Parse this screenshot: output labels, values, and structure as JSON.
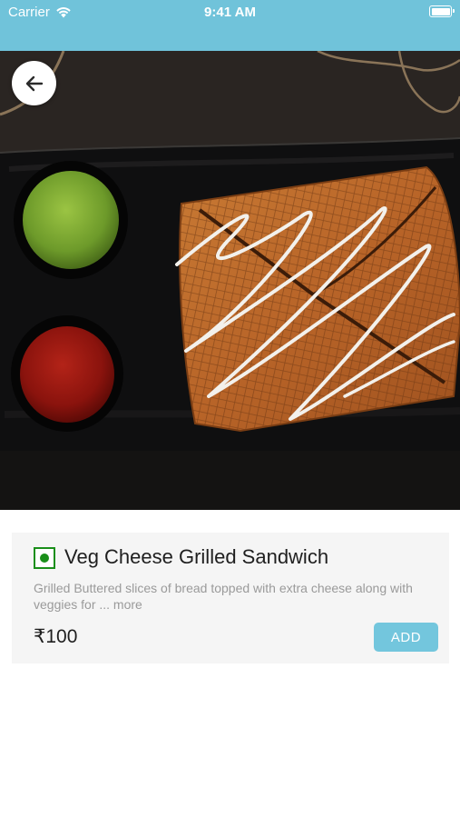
{
  "status_bar": {
    "carrier": "Carrier",
    "time": "9:41 AM",
    "background": "#70c3da"
  },
  "navigation": {
    "back_icon": "arrow-left-icon"
  },
  "hero_image": {
    "icon": "food-photo"
  },
  "product": {
    "veg_indicator_color": "#1a8f1a",
    "title": "Veg Cheese Grilled Sandwich",
    "description": "Grilled Buttered slices of bread topped with extra cheese along with veggies for ... more",
    "price": "₹100",
    "add_label": "ADD",
    "add_color": "#73c6dd"
  }
}
